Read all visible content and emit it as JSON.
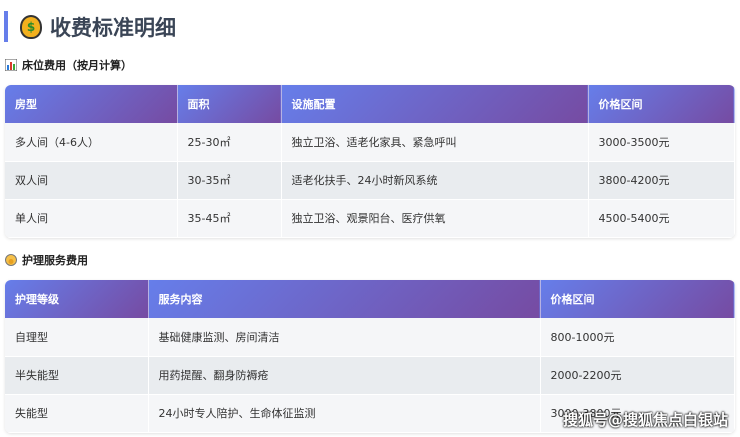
{
  "title": "收费标准明细",
  "title_icon": "money-bag-icon",
  "accent": "#667eea",
  "bed": {
    "label": "床位费用（按月计算）",
    "headers": [
      "房型",
      "面积",
      "设施配置",
      "价格区间"
    ],
    "rows": [
      [
        "多人间（4-6人）",
        "25-30㎡",
        "独立卫浴、适老化家具、紧急呼叫",
        "3000-3500元"
      ],
      [
        "双人间",
        "30-35㎡",
        "适老化扶手、24小时新风系统",
        "3800-4200元"
      ],
      [
        "单人间",
        "35-45㎡",
        "独立卫浴、观景阳台、医疗供氧",
        "4500-5400元"
      ]
    ]
  },
  "care": {
    "label": "护理服务费用",
    "headers": [
      "护理等级",
      "服务内容",
      "价格区间"
    ],
    "rows": [
      [
        "自理型",
        "基础健康监测、房间清洁",
        "800-1000元"
      ],
      [
        "半失能型",
        "用药提醒、翻身防褥疮",
        "2000-2200元"
      ],
      [
        "失能型",
        "24小时专人陪护、生命体征监测",
        "3000-3800元"
      ]
    ]
  },
  "watermark": "搜狐号@搜狐焦点白银站"
}
